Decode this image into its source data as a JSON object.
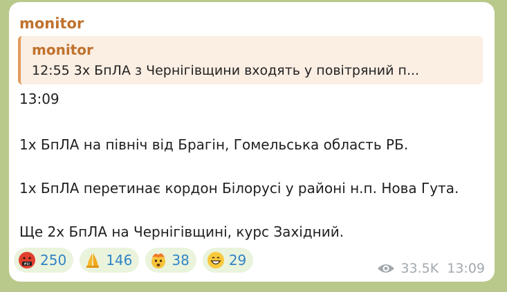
{
  "message": {
    "sender": "monitor",
    "reply": {
      "sender": "monitor",
      "text": "12:55  3х БпЛА з Чернігівщини входять у повітряний п..."
    },
    "lines": [
      "13:09",
      "1х БпЛА на північ від Брагін, Гомельська область РБ.",
      "1х БпЛА перетинає кордон Білорусі у районі н.п. Нова Гута.",
      "Ще 2х БпЛА на Чернігівщині, курс Західний."
    ],
    "reactions": [
      {
        "icon": "swearing-face-icon",
        "count": "250"
      },
      {
        "icon": "folded-hands-icon",
        "count": "146"
      },
      {
        "icon": "exploding-head-icon",
        "count": "38"
      },
      {
        "icon": "grinning-face-icon",
        "count": "29"
      }
    ],
    "views": "33.5K",
    "time": "13:09"
  },
  "colors": {
    "background": "#b9c98c",
    "sender": "#c0722d",
    "reply_bg": "#fbeee3",
    "reaction_bg": "#eaf3dc",
    "reaction_count": "#2f84c5",
    "meta": "#a2a8ae"
  }
}
